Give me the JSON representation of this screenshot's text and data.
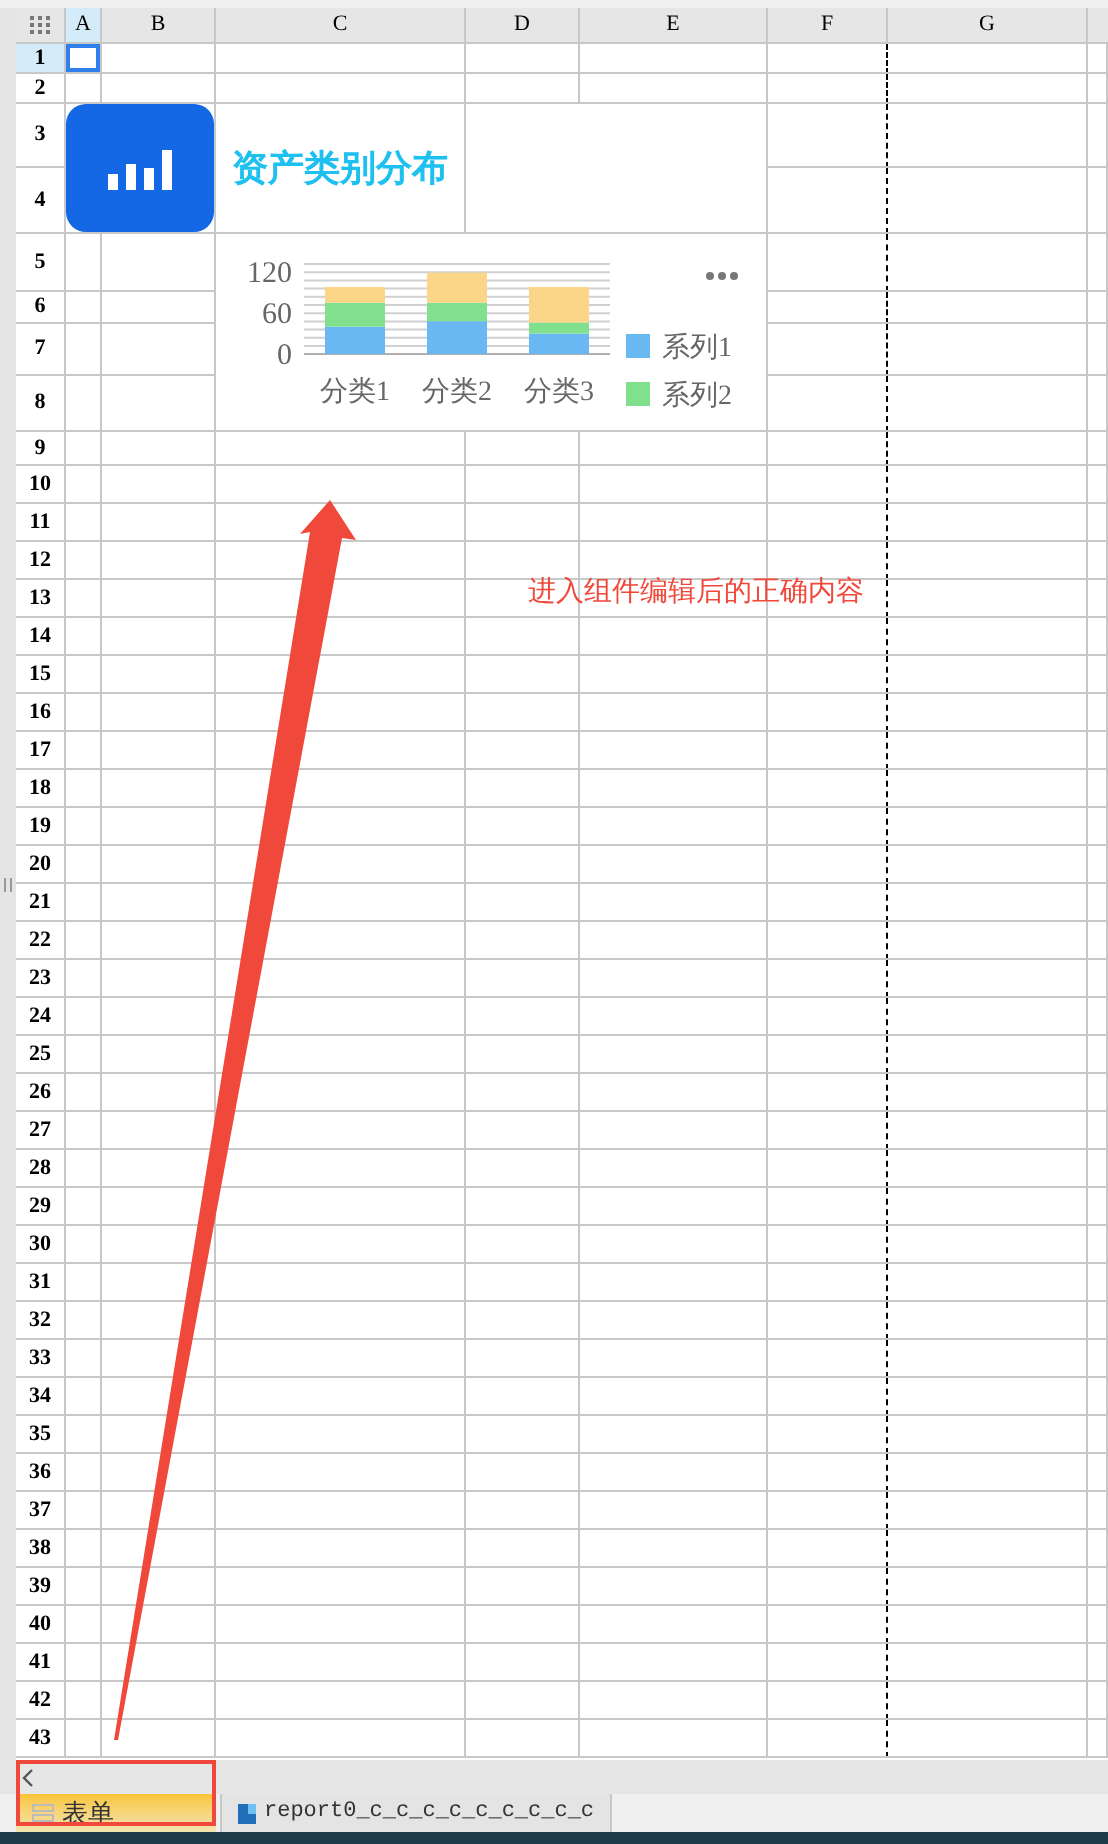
{
  "columns": [
    {
      "label": "A",
      "selected": true
    },
    {
      "label": "B",
      "selected": false
    },
    {
      "label": "C",
      "selected": false
    },
    {
      "label": "D",
      "selected": false
    },
    {
      "label": "E",
      "selected": false
    },
    {
      "label": "F",
      "selected": false
    },
    {
      "label": "G",
      "selected": false
    }
  ],
  "rows": [
    {
      "label": "1",
      "selected": true
    },
    {
      "label": "2",
      "selected": false
    },
    {
      "label": "3",
      "selected": false
    },
    {
      "label": "4",
      "selected": false
    },
    {
      "label": "5",
      "selected": false
    },
    {
      "label": "6",
      "selected": false
    },
    {
      "label": "7",
      "selected": false
    },
    {
      "label": "8",
      "selected": false
    },
    {
      "label": "9",
      "selected": false
    },
    {
      "label": "10",
      "selected": false
    },
    {
      "label": "11",
      "selected": false
    },
    {
      "label": "12",
      "selected": false
    },
    {
      "label": "13",
      "selected": false
    },
    {
      "label": "14",
      "selected": false
    },
    {
      "label": "15",
      "selected": false
    },
    {
      "label": "16",
      "selected": false
    },
    {
      "label": "17",
      "selected": false
    },
    {
      "label": "18",
      "selected": false
    },
    {
      "label": "19",
      "selected": false
    },
    {
      "label": "20",
      "selected": false
    },
    {
      "label": "21",
      "selected": false
    },
    {
      "label": "22",
      "selected": false
    },
    {
      "label": "23",
      "selected": false
    },
    {
      "label": "24",
      "selected": false
    },
    {
      "label": "25",
      "selected": false
    },
    {
      "label": "26",
      "selected": false
    },
    {
      "label": "27",
      "selected": false
    },
    {
      "label": "28",
      "selected": false
    },
    {
      "label": "29",
      "selected": false
    },
    {
      "label": "30",
      "selected": false
    },
    {
      "label": "31",
      "selected": false
    },
    {
      "label": "32",
      "selected": false
    },
    {
      "label": "33",
      "selected": false
    },
    {
      "label": "34",
      "selected": false
    },
    {
      "label": "35",
      "selected": false
    },
    {
      "label": "36",
      "selected": false
    },
    {
      "label": "37",
      "selected": false
    },
    {
      "label": "38",
      "selected": false
    },
    {
      "label": "39",
      "selected": false
    },
    {
      "label": "40",
      "selected": false
    },
    {
      "label": "41",
      "selected": false
    },
    {
      "label": "42",
      "selected": false
    },
    {
      "label": "43",
      "selected": false
    }
  ],
  "widget": {
    "title": "资产类别分布",
    "chart_data": {
      "type": "bar",
      "stacked": true,
      "legend": "right",
      "categories": [
        "分类1",
        "分类2",
        "分类3"
      ],
      "yticks": [
        0,
        60,
        120
      ],
      "ylim": [
        0,
        120
      ],
      "series": [
        {
          "name": "系列1",
          "color": "#6ab8f2",
          "values": [
            40,
            48,
            30
          ]
        },
        {
          "name": "系列2",
          "color": "#80e08e",
          "values": [
            35,
            27,
            16
          ]
        },
        {
          "color": "#fbd588",
          "values": [
            23,
            44,
            52
          ]
        }
      ]
    }
  },
  "annotation": {
    "text": "进入组件编辑后的正确内容"
  },
  "sheet_tabs": [
    {
      "label": "表单",
      "selected": true,
      "kind": "form"
    },
    {
      "label": "report0_c_c_c_c_c_c_c_c_c",
      "selected": false,
      "kind": "report"
    }
  ]
}
